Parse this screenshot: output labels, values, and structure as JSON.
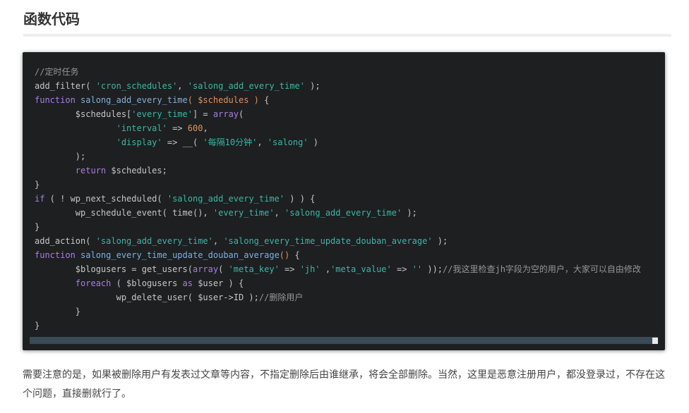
{
  "section": {
    "title": "函数代码"
  },
  "code_block": {
    "lines": [
      [
        {
          "t": "//定时任务",
          "c": "comment"
        }
      ],
      [
        {
          "t": "add_filter( ",
          "c": "op"
        },
        {
          "t": "'cron_schedules'",
          "c": "str"
        },
        {
          "t": ", ",
          "c": "op"
        },
        {
          "t": "'salong_add_every_time'",
          "c": "str"
        },
        {
          "t": " );",
          "c": "op"
        }
      ],
      [
        {
          "t": "function",
          "c": "kw"
        },
        {
          "t": " ",
          "c": "op"
        },
        {
          "t": "salong_add_every_time",
          "c": "fn"
        },
        {
          "t": "( ",
          "c": "var"
        },
        {
          "t": "$schedules",
          "c": "var"
        },
        {
          "t": " )",
          "c": "var"
        },
        {
          "t": " {",
          "c": "op"
        }
      ],
      [
        {
          "t": "        $schedules[",
          "c": "op"
        },
        {
          "t": "'every_time'",
          "c": "str"
        },
        {
          "t": "] = ",
          "c": "op"
        },
        {
          "t": "array",
          "c": "kw"
        },
        {
          "t": "(",
          "c": "op"
        }
      ],
      [
        {
          "t": "                ",
          "c": "op"
        },
        {
          "t": "'interval'",
          "c": "str"
        },
        {
          "t": " => ",
          "c": "op"
        },
        {
          "t": "600",
          "c": "num"
        },
        {
          "t": ",",
          "c": "op"
        }
      ],
      [
        {
          "t": "                ",
          "c": "op"
        },
        {
          "t": "'display'",
          "c": "str"
        },
        {
          "t": " => __( ",
          "c": "op"
        },
        {
          "t": "'每隔10分钟'",
          "c": "str"
        },
        {
          "t": ", ",
          "c": "op"
        },
        {
          "t": "'salong'",
          "c": "str"
        },
        {
          "t": " )",
          "c": "op"
        }
      ],
      [
        {
          "t": "        );",
          "c": "op"
        }
      ],
      [
        {
          "t": "        ",
          "c": "op"
        },
        {
          "t": "return",
          "c": "kw"
        },
        {
          "t": " $schedules;",
          "c": "op"
        }
      ],
      [
        {
          "t": "}",
          "c": "op"
        }
      ],
      [
        {
          "t": "if",
          "c": "kw"
        },
        {
          "t": " ( ! wp_next_scheduled( ",
          "c": "op"
        },
        {
          "t": "'salong_add_every_time'",
          "c": "str"
        },
        {
          "t": " ) ) {",
          "c": "op"
        }
      ],
      [
        {
          "t": "        wp_schedule_event( time(), ",
          "c": "op"
        },
        {
          "t": "'every_time'",
          "c": "str"
        },
        {
          "t": ", ",
          "c": "op"
        },
        {
          "t": "'salong_add_every_time'",
          "c": "str"
        },
        {
          "t": " );",
          "c": "op"
        }
      ],
      [
        {
          "t": "}",
          "c": "op"
        }
      ],
      [
        {
          "t": "add_action( ",
          "c": "op"
        },
        {
          "t": "'salong_add_every_time'",
          "c": "str"
        },
        {
          "t": ", ",
          "c": "op"
        },
        {
          "t": "'salong_every_time_update_douban_average'",
          "c": "str"
        },
        {
          "t": " );",
          "c": "op"
        }
      ],
      [
        {
          "t": "function",
          "c": "kw"
        },
        {
          "t": " ",
          "c": "op"
        },
        {
          "t": "salong_every_time_update_douban_average",
          "c": "fn"
        },
        {
          "t": "()",
          "c": "var"
        },
        {
          "t": " {",
          "c": "op"
        }
      ],
      [
        {
          "t": "        $blogusers = get_users(",
          "c": "op"
        },
        {
          "t": "array",
          "c": "kw"
        },
        {
          "t": "( ",
          "c": "op"
        },
        {
          "t": "'meta_key'",
          "c": "str"
        },
        {
          "t": " => ",
          "c": "op"
        },
        {
          "t": "'jh'",
          "c": "str"
        },
        {
          "t": " ,",
          "c": "op"
        },
        {
          "t": "'meta_value'",
          "c": "str"
        },
        {
          "t": " => ",
          "c": "op"
        },
        {
          "t": "''",
          "c": "str"
        },
        {
          "t": " ));",
          "c": "op"
        },
        {
          "t": "//我这里检查jh字段为空的用户，大家可以自由修改",
          "c": "comment"
        }
      ],
      [
        {
          "t": "        ",
          "c": "op"
        },
        {
          "t": "foreach",
          "c": "kw"
        },
        {
          "t": " ( $blogusers ",
          "c": "op"
        },
        {
          "t": "as",
          "c": "kw"
        },
        {
          "t": " $user ) {",
          "c": "op"
        }
      ],
      [
        {
          "t": "                wp_delete_user( $user->ID );",
          "c": "op"
        },
        {
          "t": "//删除用户",
          "c": "comment"
        }
      ],
      [
        {
          "t": "        }",
          "c": "op"
        }
      ],
      [
        {
          "t": "}",
          "c": "op"
        }
      ]
    ]
  },
  "note": {
    "text": "需要注意的是，如果被删除用户有发表过文章等内容，不指定删除后由谁继承，将会全部删除。当然，这里是恶意注册用户，都没登录过，不存在这个问题，直接删就行了。"
  }
}
